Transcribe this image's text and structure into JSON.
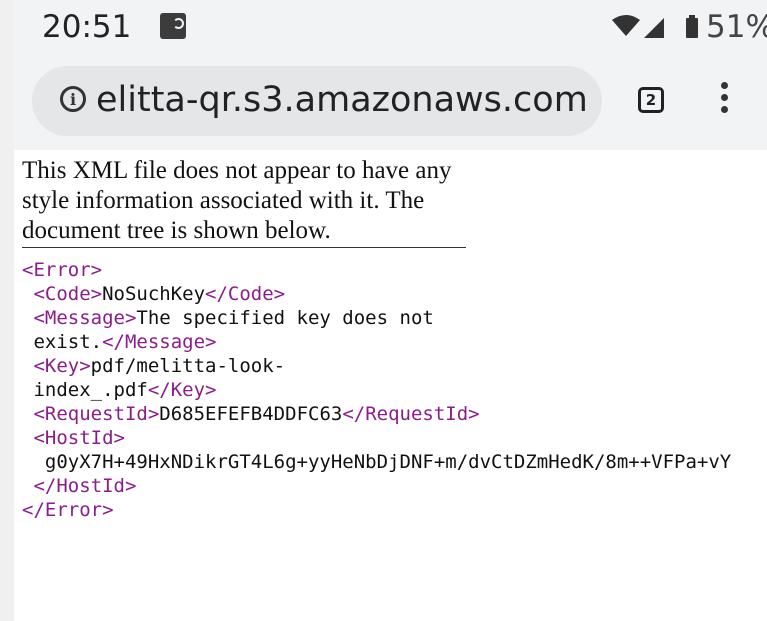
{
  "status_bar": {
    "time": "20:51",
    "battery_percent": "51%",
    "icons": [
      "notification-icon",
      "wifi-icon",
      "signal-icon",
      "battery-icon"
    ]
  },
  "browser": {
    "url": "elitta-qr.s3.amazonaws.com",
    "tab_count": "2"
  },
  "page": {
    "note": "This XML file does not appear to have any style information associated with it. The document tree is shown below.",
    "xml": {
      "error_open": "<Error>",
      "error_close": "</Error>",
      "code_open": "<Code>",
      "code_value": "NoSuchKey",
      "code_close": "</Code>",
      "message_open": "<Message>",
      "message_value_line1": "The specified key does not",
      "message_value_line2": "exist.",
      "message_close": "</Message>",
      "key_open": "<Key>",
      "key_value_line1": "pdf/melitta-look-",
      "key_value_line2": "index_.pdf",
      "key_close": "</Key>",
      "requestid_open": "<RequestId>",
      "requestid_value": "D685EFEFB4DDFC63",
      "requestid_close": "</RequestId>",
      "hostid_open": "<HostId>",
      "hostid_value": "g0yX7H+49HxNDikrGT4L6g+yyHeNbDjDNF+m/dvCtDZmHedK/8m++VFPa+vY",
      "hostid_close": "</HostId>"
    }
  },
  "colors": {
    "tag": "#8b1d8b",
    "toolbar": "#f1f3f4"
  }
}
